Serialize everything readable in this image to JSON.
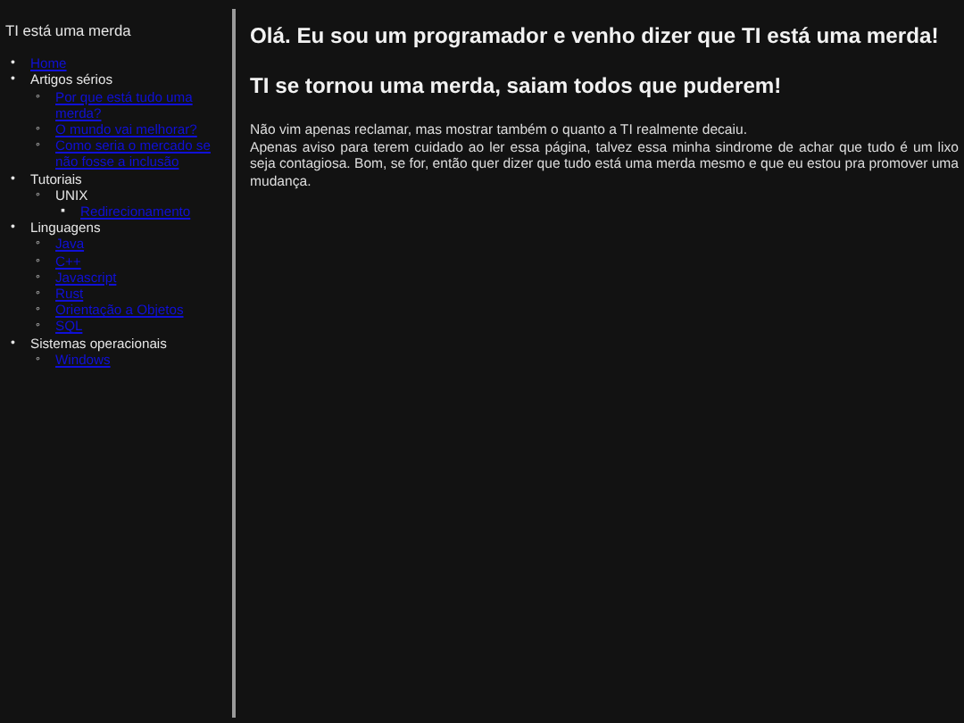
{
  "sidebar": {
    "title": "TI está uma merda",
    "items": [
      {
        "marker": "•",
        "label": "Home",
        "kind": "link"
      },
      {
        "marker": "•",
        "label": "Artigos sérios",
        "kind": "text",
        "children": [
          {
            "marker": "◦",
            "label": "Por que está tudo uma merda?",
            "kind": "link"
          },
          {
            "marker": "◦",
            "label": "O mundo vai melhorar?",
            "kind": "link"
          },
          {
            "marker": "◦",
            "label": "Como seria o mercado se não fosse a inclusão",
            "kind": "link"
          }
        ]
      },
      {
        "marker": "•",
        "label": "Tutoriais",
        "kind": "text",
        "children": [
          {
            "marker": "◦",
            "label": "UNIX",
            "kind": "text",
            "children": [
              {
                "marker": "▪",
                "label": "Redirecionamento",
                "kind": "link"
              }
            ]
          }
        ]
      },
      {
        "marker": "•",
        "label": "Linguagens",
        "kind": "text",
        "children": [
          {
            "marker": "◦",
            "label": "Java",
            "kind": "link"
          },
          {
            "marker": "◦",
            "label": "C++",
            "kind": "link"
          },
          {
            "marker": "◦",
            "label": "Javascript",
            "kind": "link"
          },
          {
            "marker": "◦",
            "label": "Rust",
            "kind": "link"
          },
          {
            "marker": "◦",
            "label": "Orientação a Objetos",
            "kind": "link"
          },
          {
            "marker": "◦",
            "label": "SQL",
            "kind": "link"
          }
        ]
      },
      {
        "marker": "•",
        "label": "Sistemas operacionais",
        "kind": "text",
        "children": [
          {
            "marker": "◦",
            "label": "Windows",
            "kind": "link"
          }
        ]
      }
    ]
  },
  "main": {
    "headings": [
      "Olá. Eu sou um programador e venho dizer que TI está uma merda!",
      "TI se tornou uma merda, saiam todos que puderem!"
    ],
    "paragraphs": [
      "Não vim apenas reclamar, mas mostrar também o quanto a TI realmente decaiu.",
      "Apenas aviso para terem cuidado ao ler essa página, talvez essa minha sindrome de achar que tudo é um lixo seja contagiosa. Bom, se for, então quer dizer que tudo está uma merda mesmo e que eu estou pra promover uma mudança."
    ]
  }
}
